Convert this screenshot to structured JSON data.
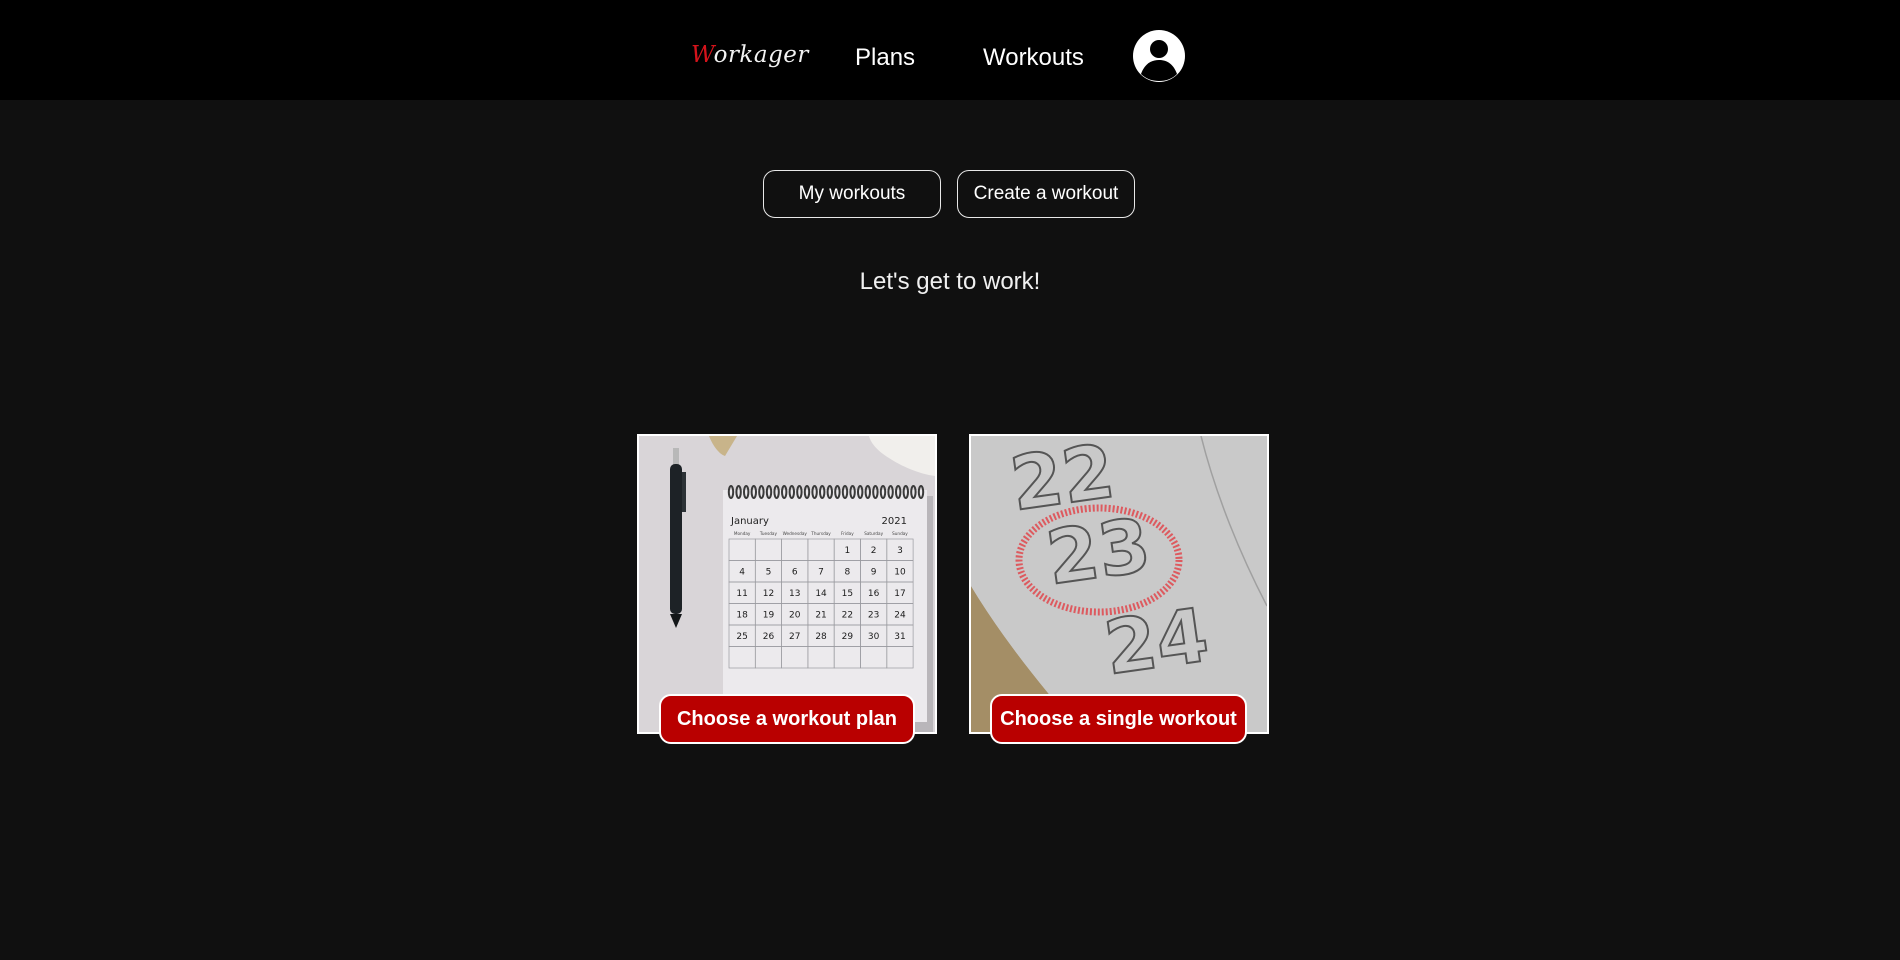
{
  "header": {
    "logo": {
      "first": "W",
      "rest": "orkager"
    },
    "nav": [
      {
        "label": "Plans"
      },
      {
        "label": "Workouts"
      }
    ],
    "profile_icon": "user-circle-icon"
  },
  "subnav": {
    "my_workouts_label": "My workouts",
    "create_workout_label": "Create a workout"
  },
  "tagline": "Let's get to work!",
  "cards": {
    "plan": {
      "button_label": "Choose a workout plan",
      "calendar": {
        "month": "January",
        "year": "2021",
        "weekdays": [
          "Monday",
          "Tuesday",
          "Wednesday",
          "Thursday",
          "Friday",
          "Saturday",
          "Sunday"
        ],
        "first_weekday_index": 4,
        "days_in_month": 31
      }
    },
    "single": {
      "button_label": "Choose a single workout",
      "dates": [
        "22",
        "23",
        "24"
      ]
    }
  },
  "colors": {
    "accent": "#b90000",
    "logo_accent": "#d4131b",
    "background": "#101010",
    "navbar": "#000000"
  }
}
